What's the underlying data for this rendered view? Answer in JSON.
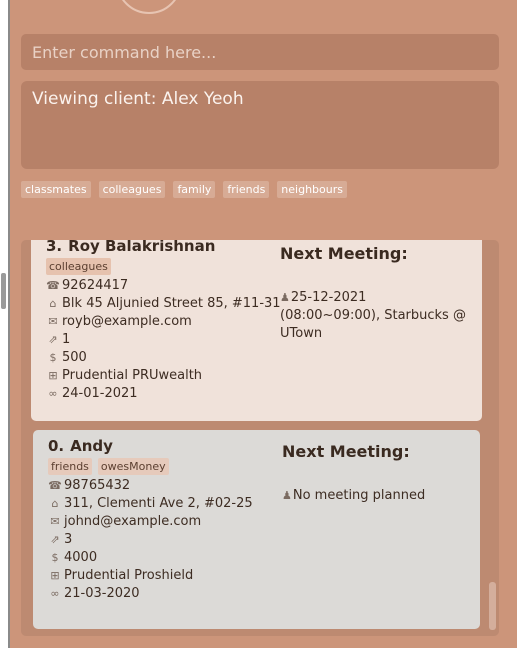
{
  "command": {
    "placeholder": "Enter command here..."
  },
  "result": {
    "text": "Viewing client: Alex Yeoh"
  },
  "tag_filters": [
    "classmates",
    "colleagues",
    "family",
    "friends",
    "neighbours"
  ],
  "clients": [
    {
      "index": "3.",
      "name": "Roy Balakrishnan",
      "tags": [
        "colleagues"
      ],
      "phone": "92624417",
      "address": "Blk 45 Aljunied Street 85, #11-31",
      "email": "royb@example.com",
      "risk": "1",
      "income": "500",
      "plan": "Prudential PRUwealth",
      "last_met": "24-01-2021",
      "meeting_label": "Next Meeting:",
      "meeting": "25-12-2021 (08:00~09:00), Starbucks @ UTown"
    },
    {
      "index": "0.",
      "name": "Andy",
      "tags": [
        "friends",
        "owesMoney"
      ],
      "phone": "98765432",
      "address": "311, Clementi Ave 2, #02-25",
      "email": "johnd@example.com",
      "risk": "3",
      "income": "4000",
      "plan": "Prudential Proshield",
      "last_met": "21-03-2020",
      "meeting_label": "Next Meeting:",
      "meeting": "No meeting planned"
    }
  ],
  "icons": {
    "phone": "phone-icon",
    "address": "house-icon",
    "email": "envelope-icon",
    "risk": "chart-icon",
    "income": "money-bag-icon",
    "plan": "bank-icon",
    "last_met": "handshake-icon",
    "meeting": "meeting-icon"
  },
  "colors": {
    "background": "#cc957a",
    "field": "#b78168",
    "selected_card": "#f0e2da",
    "card": "#dcdad7"
  }
}
